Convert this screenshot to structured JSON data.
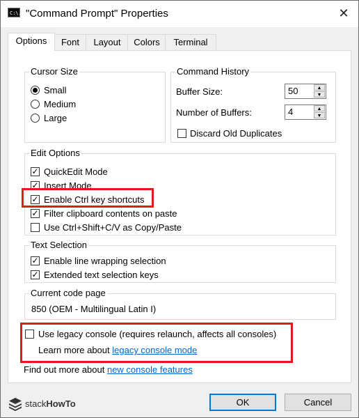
{
  "window": {
    "title": "\"Command Prompt\" Properties",
    "icon_text": "C:\\."
  },
  "tabs": [
    {
      "label": "Options"
    },
    {
      "label": "Font"
    },
    {
      "label": "Layout"
    },
    {
      "label": "Colors"
    },
    {
      "label": "Terminal"
    }
  ],
  "cursor_size": {
    "title": "Cursor Size",
    "options": [
      {
        "label": "Small",
        "selected": true
      },
      {
        "label": "Medium",
        "selected": false
      },
      {
        "label": "Large",
        "selected": false
      }
    ]
  },
  "command_history": {
    "title": "Command History",
    "buffer_size_label": "Buffer Size:",
    "buffer_size_value": "50",
    "num_buffers_label": "Number of Buffers:",
    "num_buffers_value": "4",
    "discard_label": "Discard Old Duplicates",
    "discard_checked": false
  },
  "edit_options": {
    "title": "Edit Options",
    "items": [
      {
        "label": "QuickEdit Mode",
        "checked": true
      },
      {
        "label": "Insert Mode",
        "checked": true
      },
      {
        "label": "Enable Ctrl key shortcuts",
        "checked": true
      },
      {
        "label": "Filter clipboard contents on paste",
        "checked": true
      },
      {
        "label": "Use Ctrl+Shift+C/V as Copy/Paste",
        "checked": false
      }
    ]
  },
  "text_selection": {
    "title": "Text Selection",
    "items": [
      {
        "label": "Enable line wrapping selection",
        "checked": true
      },
      {
        "label": "Extended text selection keys",
        "checked": true
      }
    ]
  },
  "code_page": {
    "title": "Current code page",
    "value": "850  (OEM - Multilingual Latin I)"
  },
  "legacy": {
    "label": "Use legacy console (requires relaunch, affects all consoles)",
    "checked": false,
    "learn_prefix": "Learn more about ",
    "learn_link": "legacy console mode"
  },
  "find_out": {
    "prefix": "Find out more about ",
    "link": "new console features"
  },
  "logo_text": {
    "part1": "stack",
    "part2": "HowTo"
  },
  "buttons": {
    "ok": "OK",
    "cancel": "Cancel"
  },
  "colors": {
    "highlight": "#e0191d",
    "link": "#0066cc",
    "accent": "#0078d7"
  }
}
